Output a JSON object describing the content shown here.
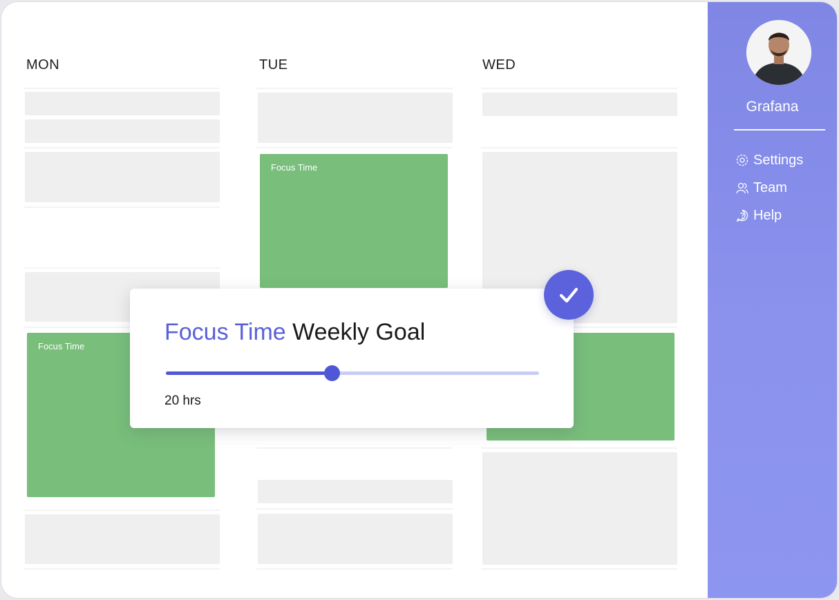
{
  "days": [
    "MON",
    "TUE",
    "WED"
  ],
  "events": {
    "tue_label": "Focus Time",
    "mon_label": "Focus Time"
  },
  "sidebar": {
    "org_name": "Grafana",
    "items": [
      {
        "label": "Settings",
        "icon": "gear-icon"
      },
      {
        "label": "Team",
        "icon": "team-icon"
      },
      {
        "label": "Help",
        "icon": "help-icon"
      }
    ]
  },
  "goal_card": {
    "title_accent": "Focus Time",
    "title_rest": " Weekly Goal",
    "value_label": "20 hrs",
    "slider_fraction": 0.445,
    "status_icon": "check-icon"
  },
  "colors": {
    "accent": "#5a60d8",
    "event_green": "#79be7b",
    "sidebar": "#8a92ee"
  }
}
